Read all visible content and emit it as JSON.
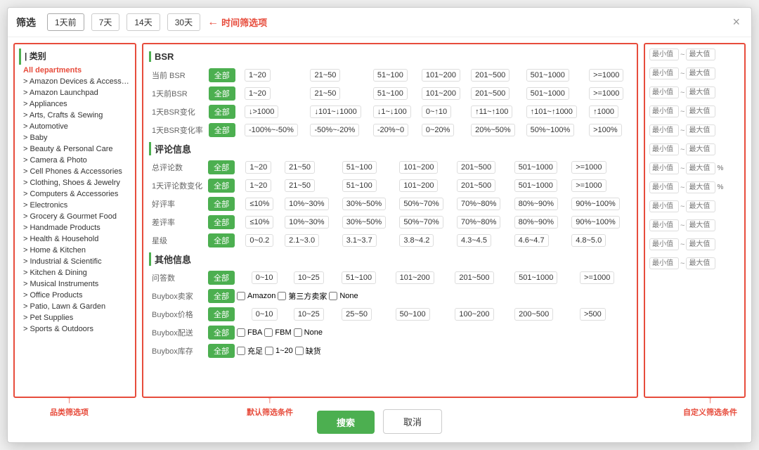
{
  "modal": {
    "title": "筛选",
    "close_label": "×",
    "time_buttons": [
      "1天前",
      "7天",
      "14天",
      "30天"
    ],
    "time_label": "时间筛选项",
    "left_section_title": "| 类别",
    "categories": [
      {
        "label": "All departments",
        "active": true
      },
      {
        "label": "> Amazon Devices & Accessories",
        "active": false
      },
      {
        "label": "> Amazon Launchpad",
        "active": false
      },
      {
        "label": "> Appliances",
        "active": false
      },
      {
        "label": "> Arts, Crafts & Sewing",
        "active": false
      },
      {
        "label": "> Automotive",
        "active": false
      },
      {
        "label": "> Baby",
        "active": false
      },
      {
        "label": "> Beauty & Personal Care",
        "active": false
      },
      {
        "label": "> Camera & Photo",
        "active": false
      },
      {
        "label": "> Cell Phones & Accessories",
        "active": false
      },
      {
        "label": "> Clothing, Shoes & Jewelry",
        "active": false
      },
      {
        "label": "> Computers & Accessories",
        "active": false
      },
      {
        "label": "> Electronics",
        "active": false
      },
      {
        "label": "> Grocery & Gourmet Food",
        "active": false
      },
      {
        "label": "> Handmade Products",
        "active": false
      },
      {
        "label": "> Health & Household",
        "active": false
      },
      {
        "label": "> Home & Kitchen",
        "active": false
      },
      {
        "label": "> Industrial & Scientific",
        "active": false
      },
      {
        "label": "> Kitchen & Dining",
        "active": false
      },
      {
        "label": "> Musical Instruments",
        "active": false
      },
      {
        "label": "> Office Products",
        "active": false
      },
      {
        "label": "> Patio, Lawn & Garden",
        "active": false
      },
      {
        "label": "> Pet Supplies",
        "active": false
      },
      {
        "label": "> Sports & Outdoors",
        "active": false
      }
    ],
    "left_annotation": "品类筛选项",
    "middle_annotation": "默认筛选条件",
    "right_annotation": "自定义筛选条件",
    "bsr_section": {
      "title": "BSR",
      "rows": [
        {
          "label": "当前 BSR",
          "options": [
            "全部",
            "1~20",
            "21~50",
            "51~100",
            "101~200",
            "201~500",
            "501~1000",
            ">=1000"
          ]
        },
        {
          "label": "1天前BSR",
          "options": [
            "全部",
            "1~20",
            "21~50",
            "51~100",
            "101~200",
            "201~500",
            "501~1000",
            ">=1000"
          ]
        },
        {
          "label": "1天BSR变化",
          "options": [
            "全部",
            "↓>1000",
            "↓101~↓1000",
            "↓1~↓100",
            "0~↑10",
            "↑11~↑100",
            "↑101~↑1000",
            "↑1000"
          ]
        },
        {
          "label": "1天BSR变化率",
          "options": [
            "全部",
            "-100%~-50%",
            "-50%~-20%",
            "-20%~0",
            "0~20%",
            "20%~50%",
            "50%~100%",
            ">100%"
          ]
        }
      ]
    },
    "comment_section": {
      "title": "评论信息",
      "rows": [
        {
          "label": "总评论数",
          "options": [
            "全部",
            "1~20",
            "21~50",
            "51~100",
            "101~200",
            "201~500",
            "501~1000",
            ">=1000"
          ]
        },
        {
          "label": "1天评论数变化",
          "options": [
            "全部",
            "1~20",
            "21~50",
            "51~100",
            "101~200",
            "201~500",
            "501~1000",
            ">=1000"
          ]
        },
        {
          "label": "好评率",
          "options": [
            "全部",
            "≤10%",
            "10%~30%",
            "30%~50%",
            "50%~70%",
            "70%~80%",
            "80%~90%",
            "90%~100%"
          ]
        },
        {
          "label": "差评率",
          "options": [
            "全部",
            "≤10%",
            "10%~30%",
            "30%~50%",
            "50%~70%",
            "70%~80%",
            "80%~90%",
            "90%~100%"
          ]
        },
        {
          "label": "星级",
          "options": [
            "全部",
            "0~0.2",
            "2.1~3.0",
            "3.1~3.7",
            "3.8~4.2",
            "4.3~4.5",
            "4.6~4.7",
            "4.8~5.0"
          ]
        }
      ]
    },
    "other_section": {
      "title": "其他信息",
      "rows": [
        {
          "label": "问答数",
          "type": "buttons",
          "options": [
            "全部",
            "0~10",
            "10~25",
            "51~100",
            "101~200",
            "201~500",
            "501~1000",
            ">=1000"
          ]
        },
        {
          "label": "Buybox卖家",
          "type": "checkbox",
          "options": [
            "全部",
            "Amazon",
            "第三方卖家",
            "None"
          ]
        },
        {
          "label": "Buybox价格",
          "type": "buttons",
          "options": [
            "全部",
            "0~10",
            "10~25",
            "25~50",
            "50~100",
            "100~200",
            "200~500",
            ">500"
          ]
        },
        {
          "label": "Buybox配送",
          "type": "checkbox",
          "options": [
            "全部",
            "FBA",
            "FBM",
            "None"
          ]
        },
        {
          "label": "Buybox库存",
          "type": "checkbox",
          "options": [
            "全部",
            "充足",
            "1~20",
            "缺货"
          ]
        }
      ]
    },
    "footer": {
      "search_label": "搜索",
      "cancel_label": "取消"
    },
    "right_panel": {
      "rows": [
        {
          "placeholder_min": "最小值",
          "placeholder_max": "最大值",
          "unit": ""
        },
        {
          "placeholder_min": "最小值",
          "placeholder_max": "最大值",
          "unit": ""
        },
        {
          "placeholder_min": "最小值",
          "placeholder_max": "最大值",
          "unit": ""
        },
        {
          "placeholder_min": "最小值",
          "placeholder_max": "最大值",
          "unit": ""
        },
        {
          "placeholder_min": "最小值",
          "placeholder_max": "最大值",
          "unit": ""
        },
        {
          "placeholder_min": "最小值",
          "placeholder_max": "最大值",
          "unit": ""
        },
        {
          "placeholder_min": "最小值",
          "placeholder_max": "最大值",
          "unit": "%"
        },
        {
          "placeholder_min": "最小值",
          "placeholder_max": "最大值",
          "unit": "%"
        },
        {
          "placeholder_min": "最小值",
          "placeholder_max": "最大值",
          "unit": ""
        },
        {
          "placeholder_min": "最小值",
          "placeholder_max": "最大值",
          "unit": ""
        },
        {
          "placeholder_min": "最小值",
          "placeholder_max": "最大值",
          "unit": ""
        },
        {
          "placeholder_min": "最小值",
          "placeholder_max": "最大值",
          "unit": ""
        }
      ]
    }
  }
}
